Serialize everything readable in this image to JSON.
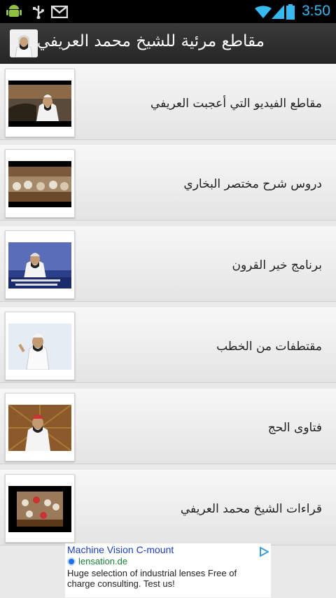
{
  "status_bar": {
    "time": "3:50",
    "icons": [
      "android-icon",
      "usb-icon",
      "gmail-icon",
      "wifi-icon",
      "signal-icon",
      "battery-icon"
    ]
  },
  "header": {
    "title": "مقاطع مرئية للشيخ محمد العريفي",
    "icon": "app-icon"
  },
  "list": {
    "items": [
      {
        "label": "مقاطع الفيديو التي أعجبت العريفي"
      },
      {
        "label": "دروس شرح مختصر البخاري"
      },
      {
        "label": "برنامج خير القرون"
      },
      {
        "label": "مقتطفات من الخطب"
      },
      {
        "label": "فتاوى الحج"
      },
      {
        "label": "قراءات الشيخ محمد العريفي"
      }
    ]
  },
  "ad": {
    "title": "Machine Vision C-mount",
    "domain": "lensation.de",
    "text": "Huge selection of industrial lenses Free of charge consulting. Test us!"
  },
  "colors": {
    "time": "#36b9f0",
    "header_bg": "#2e2e2e",
    "ad_title": "#1a3fbf",
    "ad_domain": "#188038"
  }
}
